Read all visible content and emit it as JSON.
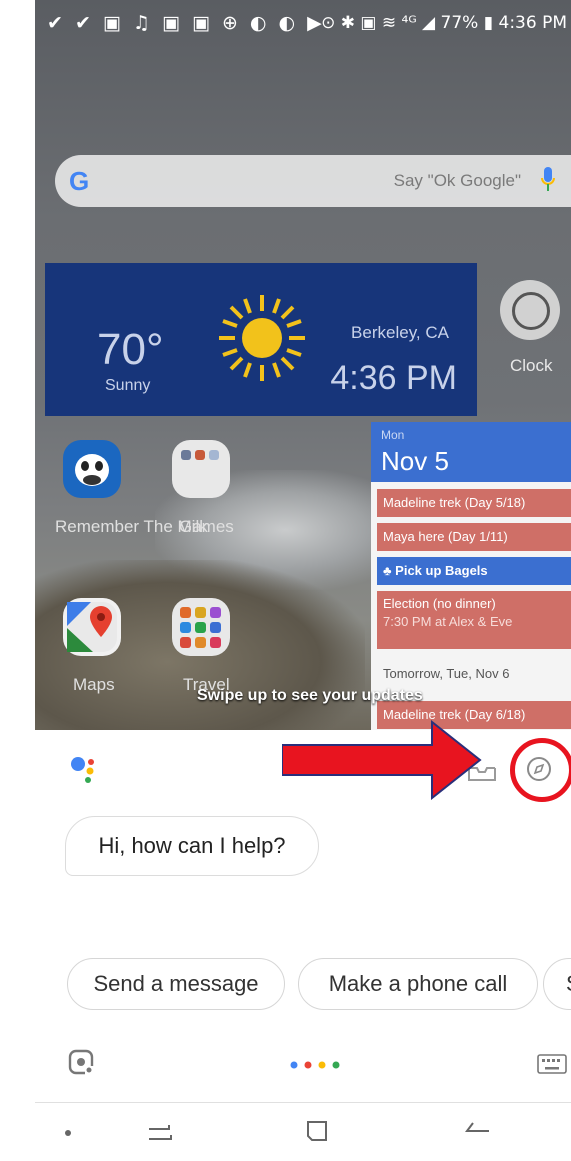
{
  "status_bar": {
    "left_icons": "✔ ✔ ▣ ♫ ▣ ▣ ⊕ ◐ ◐ ▶",
    "right_icons": "⊙ ✱ ▣ ≋ ⁴ᴳ ◢",
    "battery": "77%",
    "time": "4:36 PM"
  },
  "search": {
    "logo": "G",
    "hint": "Say \"Ok Google\""
  },
  "weather": {
    "temperature": "70°",
    "condition": "Sunny",
    "city": "Berkeley, CA",
    "time": "4:36 PM"
  },
  "clock_app": {
    "label": "Clock"
  },
  "apps": [
    {
      "label": "Remember The Milk"
    },
    {
      "label": "Games"
    },
    {
      "label": "Maps"
    },
    {
      "label": "Travel"
    }
  ],
  "calendar": {
    "weekday": "Mon",
    "date": "Nov 5",
    "events": [
      {
        "title": "Madeline trek (Day 5/18)"
      },
      {
        "title": "Maya here  (Day 1/11)"
      },
      {
        "title": "Pick up Bagels"
      },
      {
        "title": "Election (no dinner)",
        "detail": "7:30 PM at Alex & Eve"
      }
    ],
    "tomorrow_header": "Tomorrow, Tue, Nov 6",
    "tomorrow_event": "Madeline trek (Day 6/18)"
  },
  "swipe_hint": "Swipe up to see your updates",
  "assistant": {
    "greeting": "Hi, how can I help?",
    "suggestions": [
      "Send a message",
      "Make a phone call",
      "S"
    ]
  },
  "colors": {
    "annotation_red": "#e8141f",
    "weather_bg": "#17357a",
    "calendar_header": "#3b6fd0",
    "event_red": "#cf6f67"
  },
  "icons": {
    "assistant_logo": "google-assistant-dots-icon",
    "inbox": "inbox-icon",
    "explore": "compass-icon",
    "lens": "lens-icon",
    "keyboard": "keyboard-icon"
  }
}
